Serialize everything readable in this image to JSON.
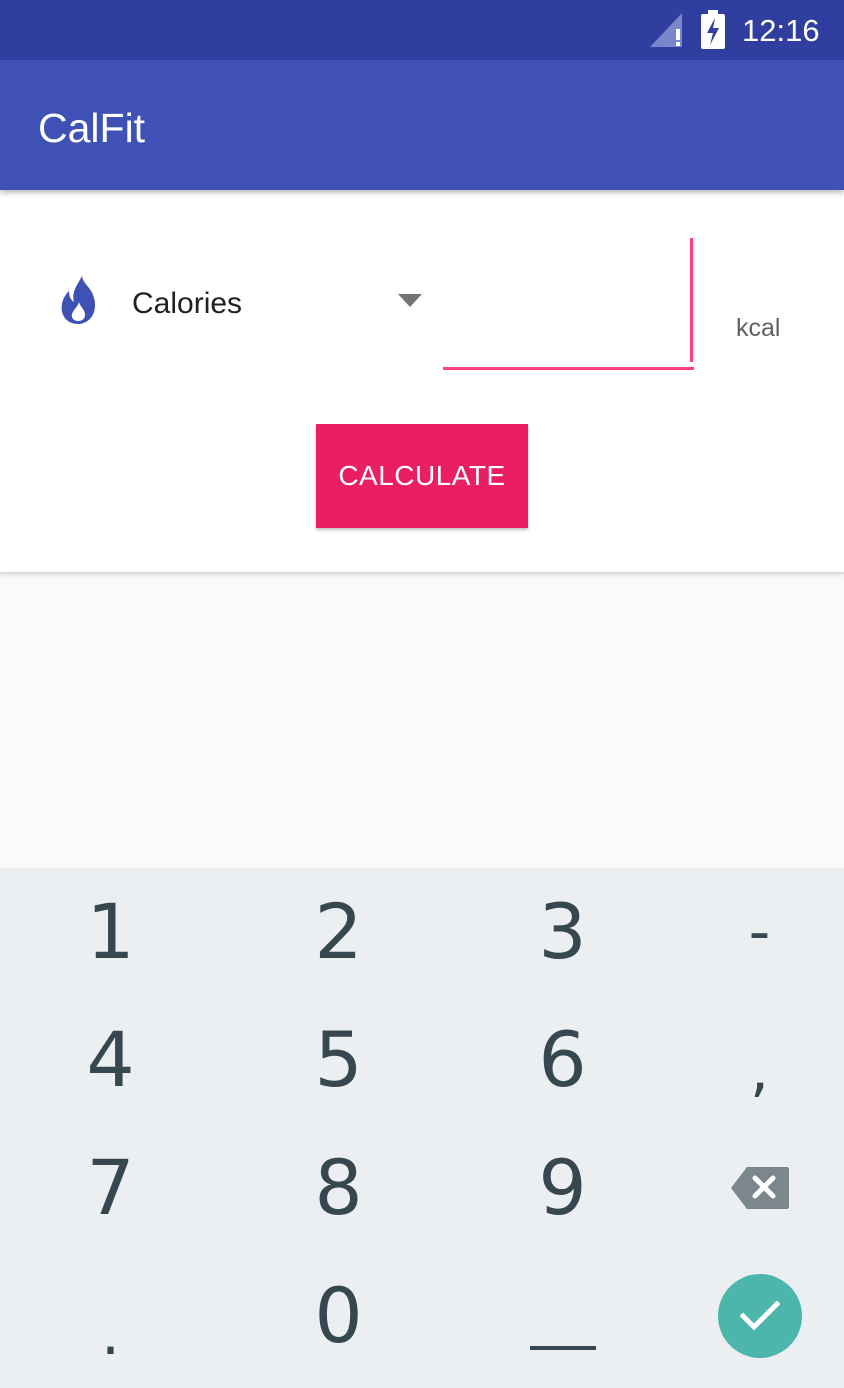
{
  "status_bar": {
    "time": "12:16",
    "icons": [
      "signal-icon",
      "battery-charging-icon"
    ],
    "color": "#303f9f"
  },
  "app_bar": {
    "title": "CalFit",
    "color": "#3f51b5"
  },
  "form": {
    "icon": "flame-icon",
    "spinner": {
      "selected": "Calories"
    },
    "value_input": {
      "value": "",
      "placeholder": ""
    },
    "unit": "kcal",
    "calculate_label": "CALCULATE",
    "accent_color": "#e91e63",
    "input_accent_color": "#ff4081"
  },
  "keyboard": {
    "keys": {
      "k1": "1",
      "k2": "2",
      "k3": "3",
      "dash": "-",
      "k4": "4",
      "k5": "5",
      "k6": "6",
      "comma": ",",
      "k7": "7",
      "k8": "8",
      "k9": "9",
      "backspace": "backspace-icon",
      "dot": ".",
      "k0": "0",
      "space": "space-icon",
      "done": "check-icon"
    },
    "background": "#eceff1",
    "done_color": "#4db6ac"
  }
}
